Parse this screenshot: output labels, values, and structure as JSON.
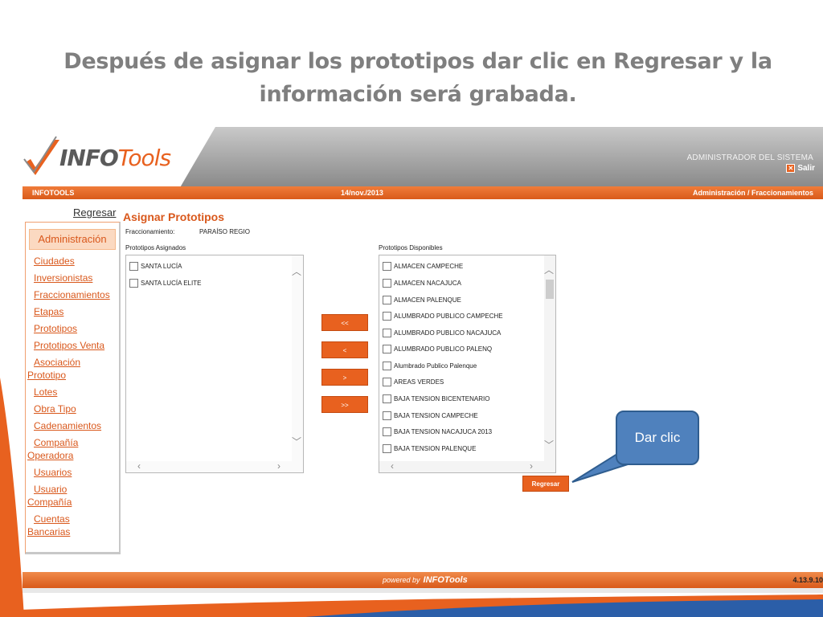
{
  "slide": {
    "title_line1": "Después de asignar los prototipos dar clic en Regresar y la",
    "title_line2": "información será grabada."
  },
  "header": {
    "logo_info": "INFO",
    "logo_tools": "Tools",
    "role": "ADMINISTRADOR DEL SISTEMA",
    "salir": "Salir",
    "salir_icon": "close-icon"
  },
  "topbar": {
    "app_name": "INFOTOOLS",
    "date": "14/nov./2013",
    "breadcrumb": "Administración / Fraccionamientos"
  },
  "nav": {
    "regresar_link": "Regresar",
    "section": "Administración",
    "items": [
      {
        "line1": "Ciudades",
        "line2": ""
      },
      {
        "line1": "Inversionistas",
        "line2": ""
      },
      {
        "line1": "Fraccionamientos",
        "line2": ""
      },
      {
        "line1": "Etapas",
        "line2": ""
      },
      {
        "line1": "Prototipos",
        "line2": ""
      },
      {
        "line1": "Prototipos Venta",
        "line2": ""
      },
      {
        "line1": "Asociación",
        "line2": "Prototipo"
      },
      {
        "line1": "Lotes",
        "line2": ""
      },
      {
        "line1": "Obra Tipo",
        "line2": ""
      },
      {
        "line1": "Cadenamientos",
        "line2": ""
      },
      {
        "line1": "Compañía",
        "line2": "Operadora"
      },
      {
        "line1": "Usuarios",
        "line2": ""
      },
      {
        "line1": "Usuario",
        "line2": "Compañía"
      },
      {
        "line1": "Cuentas",
        "line2": "Bancarias"
      }
    ]
  },
  "panel": {
    "title": "Asignar Prototipos",
    "fraccionamiento_label": "Fraccionamiento:",
    "fraccionamiento_value": "PARAÍSO REGIO",
    "assigned_label": "Prototipos Asignados",
    "available_label": "Prototipos Disponibles",
    "assigned": [
      "SANTA LUCÍA",
      "SANTA LUCÍA ELITE"
    ],
    "available": [
      "ALMACEN CAMPECHE",
      "ALMACEN NACAJUCA",
      "ALMACEN PALENQUE",
      "ALUMBRADO PUBLICO CAMPECHE",
      "ALUMBRADO PUBLICO NACAJUCA",
      "ALUMBRADO PUBLICO PALENQ",
      "Alumbrado Publico Palenque",
      "AREAS VERDES",
      "BAJA TENSION BICENTENARIO",
      "BAJA TENSION CAMPECHE",
      "BAJA TENSION NACAJUCA 2013",
      "BAJA TENSION PALENQUE"
    ],
    "btn_add_all": "<<",
    "btn_add": "<",
    "btn_remove": ">",
    "btn_remove_all": ">>",
    "regresar_button": "Regresar"
  },
  "footer": {
    "powered_by": "powered by",
    "powered_logo": "INFOTools",
    "version": "4.13.9.10"
  },
  "callout": {
    "text": "Dar clic"
  },
  "colors": {
    "accent": "#e8611f",
    "callout": "#4f81bd",
    "title_gray": "#7f7f7f"
  }
}
